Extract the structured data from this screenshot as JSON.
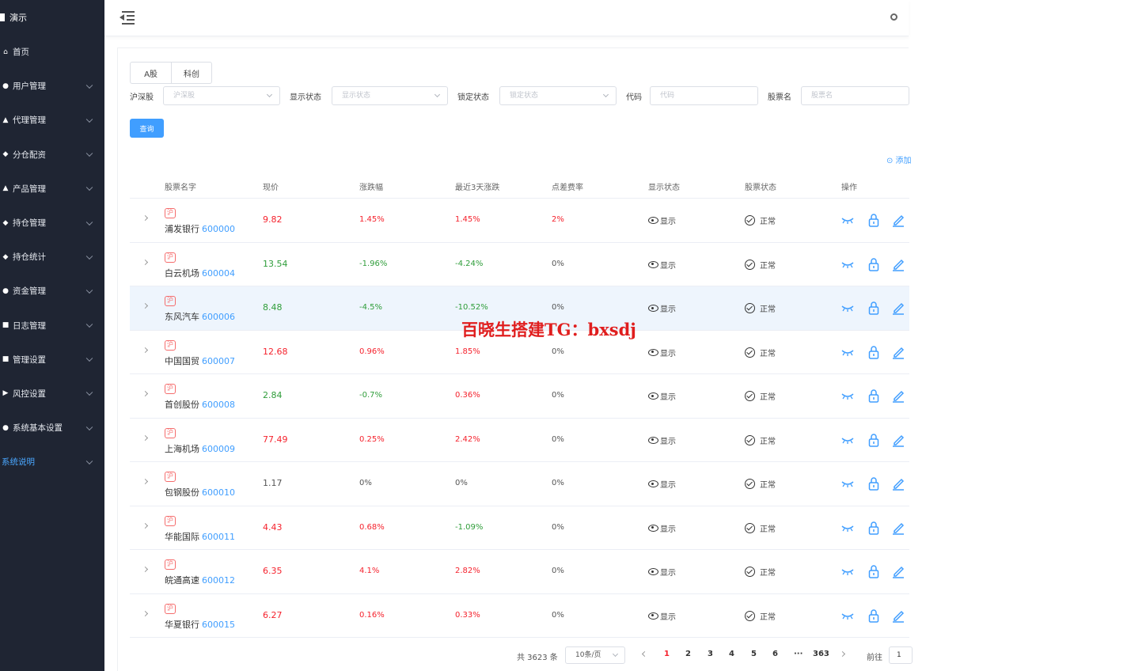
{
  "sidebar": {
    "brand": "演示",
    "items": [
      {
        "label": "首页",
        "icon": "home-icon",
        "glyph": "⌂",
        "has_children": false
      },
      {
        "label": "用户管理",
        "icon": "user-icon",
        "glyph": "●",
        "has_children": true
      },
      {
        "label": "代理管理",
        "icon": "agent-icon",
        "glyph": "▲",
        "has_children": true
      },
      {
        "label": "分仓配资",
        "icon": "allocate-icon",
        "glyph": "◆",
        "has_children": true
      },
      {
        "label": "产品管理",
        "icon": "product-icon",
        "glyph": "▲",
        "has_children": true
      },
      {
        "label": "持仓管理",
        "icon": "position-icon",
        "glyph": "◆",
        "has_children": true
      },
      {
        "label": "持仓统计",
        "icon": "stats-icon",
        "glyph": "◆",
        "has_children": true
      },
      {
        "label": "资金管理",
        "icon": "fund-icon",
        "glyph": "●",
        "has_children": true
      },
      {
        "label": "日志管理",
        "icon": "log-icon",
        "glyph": "■",
        "has_children": true
      },
      {
        "label": "管理设置",
        "icon": "admin-icon",
        "glyph": "■",
        "has_children": true
      },
      {
        "label": "风控设置",
        "icon": "risk-icon",
        "glyph": "▶",
        "has_children": true
      },
      {
        "label": "系统基本设置",
        "icon": "settings-icon",
        "glyph": "●",
        "has_children": true
      },
      {
        "label": "系统说明",
        "icon": "",
        "glyph": "",
        "has_children": true
      }
    ]
  },
  "tabs": [
    "A股",
    "科创"
  ],
  "filters": {
    "market": {
      "label": "沪深股",
      "placeholder": "沪深股"
    },
    "display": {
      "label": "显示状态",
      "placeholder": "显示状态"
    },
    "lock": {
      "label": "锁定状态",
      "placeholder": "锁定状态"
    },
    "code": {
      "label": "代码",
      "placeholder": "代码"
    },
    "name": {
      "label": "股票名",
      "placeholder": "股票名"
    }
  },
  "query_label": "查询",
  "add_label": "⊙ 添加",
  "table": {
    "headers": [
      "股票名字",
      "现价",
      "涨跌幅",
      "最近3天涨跌",
      "点差费率",
      "显示状态",
      "股票状态",
      "操作"
    ],
    "rows": [
      {
        "badge": "沪",
        "name": "浦发银行",
        "code": "600000",
        "price": "9.82",
        "price_dir": "up",
        "change": "1.45%",
        "change_dir": "up",
        "change3": "1.45%",
        "change3_dir": "up",
        "fee": "2%",
        "fee_dir": "up",
        "display": "显示",
        "status": "正常"
      },
      {
        "badge": "沪",
        "name": "白云机场",
        "code": "600004",
        "price": "13.54",
        "price_dir": "down",
        "change": "-1.96%",
        "change_dir": "down",
        "change3": "-4.24%",
        "change3_dir": "down",
        "fee": "0%",
        "fee_dir": "flat",
        "display": "显示",
        "status": "正常"
      },
      {
        "badge": "沪",
        "name": "东风汽车",
        "code": "600006",
        "price": "8.48",
        "price_dir": "down",
        "change": "-4.5%",
        "change_dir": "down",
        "change3": "-10.52%",
        "change3_dir": "down",
        "fee": "0%",
        "fee_dir": "flat",
        "display": "显示",
        "status": "正常"
      },
      {
        "badge": "沪",
        "name": "中国国贸",
        "code": "600007",
        "price": "12.68",
        "price_dir": "up",
        "change": "0.96%",
        "change_dir": "up",
        "change3": "1.85%",
        "change3_dir": "up",
        "fee": "0%",
        "fee_dir": "flat",
        "display": "显示",
        "status": "正常"
      },
      {
        "badge": "沪",
        "name": "首创股份",
        "code": "600008",
        "price": "2.84",
        "price_dir": "down",
        "change": "-0.7%",
        "change_dir": "down",
        "change3": "0.36%",
        "change3_dir": "up",
        "fee": "0%",
        "fee_dir": "flat",
        "display": "显示",
        "status": "正常"
      },
      {
        "badge": "沪",
        "name": "上海机场",
        "code": "600009",
        "price": "77.49",
        "price_dir": "up",
        "change": "0.25%",
        "change_dir": "up",
        "change3": "2.42%",
        "change3_dir": "up",
        "fee": "0%",
        "fee_dir": "flat",
        "display": "显示",
        "status": "正常"
      },
      {
        "badge": "沪",
        "name": "包钢股份",
        "code": "600010",
        "price": "1.17",
        "price_dir": "flat",
        "change": "0%",
        "change_dir": "flat",
        "change3": "0%",
        "change3_dir": "flat",
        "fee": "0%",
        "fee_dir": "flat",
        "display": "显示",
        "status": "正常"
      },
      {
        "badge": "沪",
        "name": "华能国际",
        "code": "600011",
        "price": "4.43",
        "price_dir": "up",
        "change": "0.68%",
        "change_dir": "up",
        "change3": "-1.09%",
        "change3_dir": "down",
        "fee": "0%",
        "fee_dir": "flat",
        "display": "显示",
        "status": "正常"
      },
      {
        "badge": "沪",
        "name": "皖通高速",
        "code": "600012",
        "price": "6.35",
        "price_dir": "up",
        "change": "4.1%",
        "change_dir": "up",
        "change3": "2.82%",
        "change3_dir": "up",
        "fee": "0%",
        "fee_dir": "flat",
        "display": "显示",
        "status": "正常"
      },
      {
        "badge": "沪",
        "name": "华夏银行",
        "code": "600015",
        "price": "6.27",
        "price_dir": "up",
        "change": "0.16%",
        "change_dir": "up",
        "change3": "0.33%",
        "change3_dir": "up",
        "fee": "0%",
        "fee_dir": "flat",
        "display": "显示",
        "status": "正常"
      }
    ]
  },
  "pagination": {
    "total": "共 3623 条",
    "page_size": "10条/页",
    "pages": [
      "1",
      "2",
      "3",
      "4",
      "5",
      "6",
      "···",
      "363"
    ],
    "current": "1",
    "goto_label": "前往",
    "goto_value": "1"
  },
  "watermark": "百晓生搭建TG：bxsdj",
  "colors": {
    "sidebar_bg": "#1f2533",
    "primary": "#409eff",
    "up": "#f5222d",
    "down": "#2f9d3a",
    "row_highlight": "#eef5fd"
  }
}
